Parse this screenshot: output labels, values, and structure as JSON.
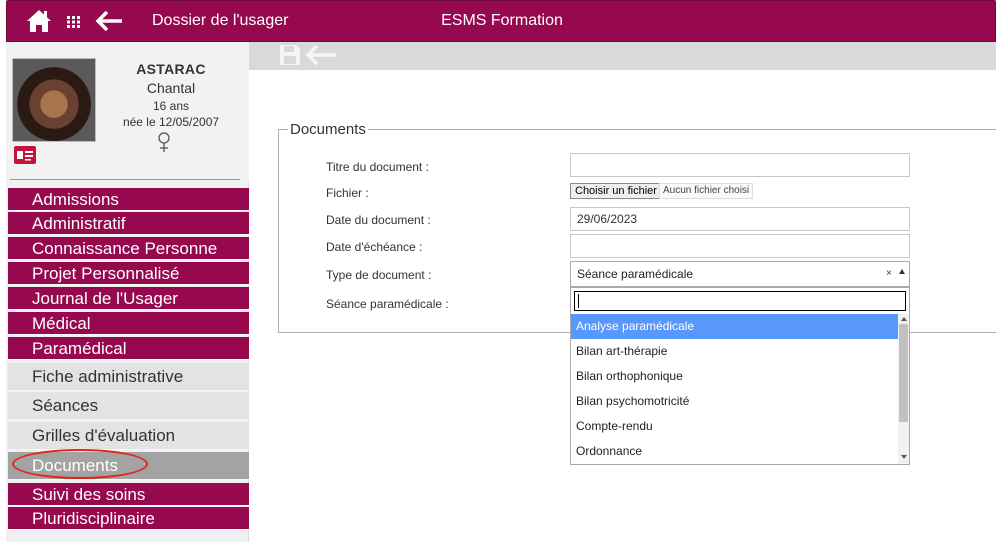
{
  "header": {
    "breadcrumb": "Dossier de l'usager",
    "center_title": "ESMS Formation",
    "icons": [
      "home-icon",
      "apps-grid-icon",
      "back-arrow-icon"
    ]
  },
  "patient": {
    "last_name": "ASTARAC",
    "first_name": "Chantal",
    "age": "16 ans",
    "birth": "née le 12/05/2007",
    "gender_icon": "female-icon"
  },
  "menu": {
    "items": [
      {
        "label": "Admissions"
      },
      {
        "label": "Administratif"
      },
      {
        "label": "Connaissance Personne"
      },
      {
        "label": "Projet Personnalisé"
      },
      {
        "label": "Journal de l'Usager"
      },
      {
        "label": "Médical"
      },
      {
        "label": "Paramédical"
      }
    ],
    "subitems": [
      {
        "label": "Fiche administrative"
      },
      {
        "label": "Séances"
      },
      {
        "label": "Grilles d'évaluation"
      },
      {
        "label": "Documents",
        "active": true
      }
    ],
    "items_after": [
      {
        "label": "Suivi des soins"
      },
      {
        "label": "Pluridisciplinaire"
      }
    ]
  },
  "form": {
    "legend": "Documents",
    "labels": {
      "title": "Titre du document :",
      "file": "Fichier :",
      "date": "Date du document :",
      "due": "Date d'échéance :",
      "type": "Type de document :",
      "session": "Séance paramédicale :"
    },
    "values": {
      "title": "",
      "date": "29/06/2023",
      "due": ""
    },
    "file_button": "Choisir un fichier",
    "file_status": "Aucun fichier choisi",
    "type_selected": "Séance paramédicale",
    "type_clear": "×",
    "dropdown_options": [
      "Analyse paramédicale",
      "Bilan art-thérapie",
      "Bilan orthophonique",
      "Bilan psychomotricité",
      "Compte-rendu",
      "Ordonnance"
    ],
    "highlighted_option": "Analyse paramédicale"
  },
  "colors": {
    "brand": "#96094f",
    "highlight": "#5897fb",
    "annotation": "#e2231a"
  }
}
